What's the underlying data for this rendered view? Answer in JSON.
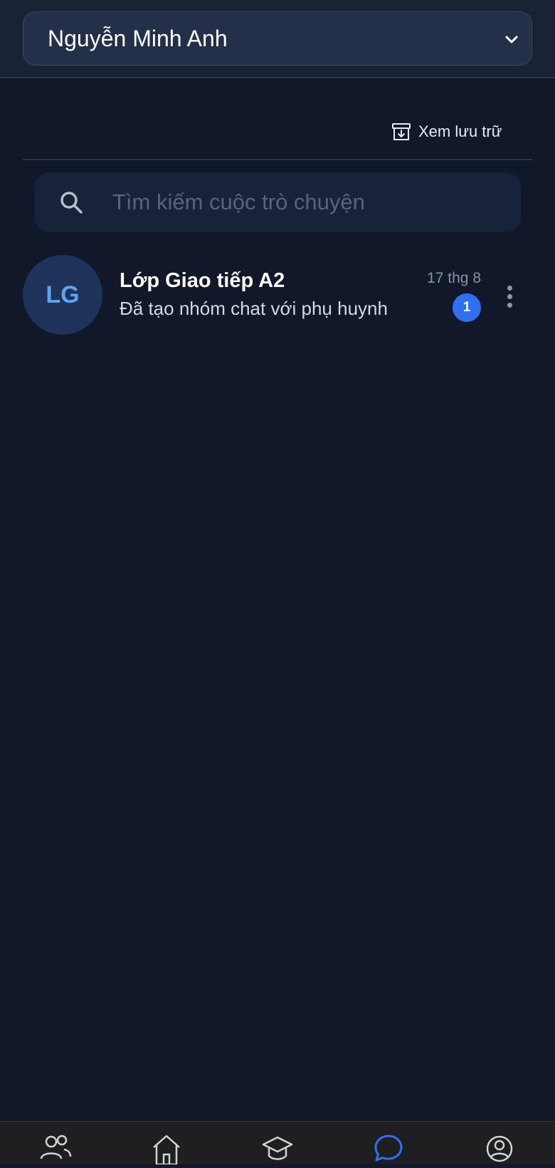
{
  "header": {
    "selected_account": "Nguyễn Minh Anh"
  },
  "archive": {
    "label": "Xem lưu trữ",
    "icon": "archive-icon"
  },
  "search": {
    "placeholder": "Tìm kiếm cuộc trò chuyện",
    "value": "",
    "icon": "search-icon"
  },
  "conversations": [
    {
      "avatar_initials": "LG",
      "title": "Lớp Giao tiếp A2",
      "preview": "Đã tạo nhóm chat với phụ huynh",
      "time": "17 thg 8",
      "unread": "1"
    }
  ],
  "bottom_nav": {
    "items": [
      {
        "icon": "users-icon",
        "active": false
      },
      {
        "icon": "home-icon",
        "active": false
      },
      {
        "icon": "graduation-cap-icon",
        "active": false
      },
      {
        "icon": "chat-icon",
        "active": true
      },
      {
        "icon": "profile-icon",
        "active": false
      }
    ]
  },
  "colors": {
    "background": "#10182a",
    "accent": "#2f6ff0",
    "avatar_text": "#5fa3f2",
    "active_nav": "#2f6ff0"
  }
}
